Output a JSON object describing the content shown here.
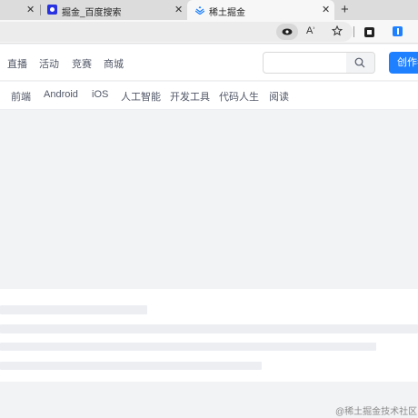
{
  "browser": {
    "tabs": [
      {
        "title": "",
        "close": "✕"
      },
      {
        "title": "掘金_百度搜索",
        "close": "✕"
      },
      {
        "title": "稀土掘金",
        "close": "✕"
      }
    ],
    "new_tab": "+"
  },
  "header": {
    "nav": [
      "直播",
      "活动",
      "竞赛",
      "商城"
    ],
    "search_placeholder": "",
    "create_label": "创作者中心"
  },
  "categories": [
    "前端",
    "Android",
    "iOS",
    "人工智能",
    "开发工具",
    "代码人生",
    "阅读"
  ],
  "watermark": "@稀土掘金技术社区",
  "colors": {
    "brand": "#1e80ff",
    "skeleton": "#eceef2",
    "page_bg": "#f2f3f5"
  }
}
